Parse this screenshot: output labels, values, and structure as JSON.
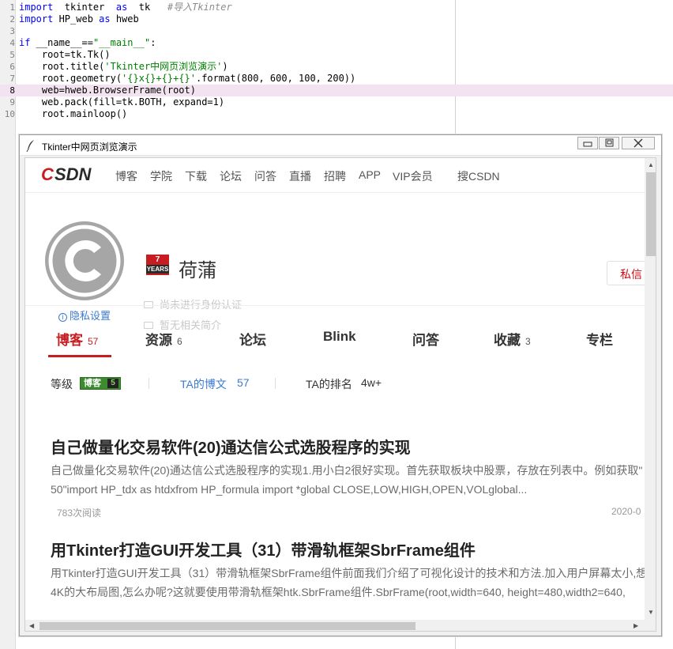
{
  "editor": {
    "lines": [
      {
        "num": "1",
        "parts": [
          {
            "t": "import",
            "c": "kw"
          },
          {
            "t": "  tkinter  ",
            "c": ""
          },
          {
            "t": "as",
            "c": "kw"
          },
          {
            "t": "  tk   ",
            "c": ""
          },
          {
            "t": "#导入Tkinter",
            "c": "cm"
          }
        ]
      },
      {
        "num": "2",
        "parts": [
          {
            "t": "import",
            "c": "kw"
          },
          {
            "t": " HP_web ",
            "c": ""
          },
          {
            "t": "as",
            "c": "kw"
          },
          {
            "t": " hweb",
            "c": ""
          }
        ]
      },
      {
        "num": "3",
        "parts": []
      },
      {
        "num": "4",
        "parts": [
          {
            "t": "if",
            "c": "kw"
          },
          {
            "t": " __name__==",
            "c": ""
          },
          {
            "t": "\"__main__\"",
            "c": "str"
          },
          {
            "t": ":",
            "c": ""
          }
        ]
      },
      {
        "num": "5",
        "parts": [
          {
            "t": "    root=tk.Tk()",
            "c": ""
          }
        ]
      },
      {
        "num": "6",
        "parts": [
          {
            "t": "    root.title(",
            "c": ""
          },
          {
            "t": "'Tkinter中网页浏览演示'",
            "c": "str"
          },
          {
            "t": ")",
            "c": ""
          }
        ]
      },
      {
        "num": "7",
        "parts": [
          {
            "t": "    root.geometry(",
            "c": ""
          },
          {
            "t": "'{}x{}+{}+{}'",
            "c": "str"
          },
          {
            "t": ".format(800, 600, 100, 200))",
            "c": ""
          }
        ]
      },
      {
        "num": "8",
        "parts": [
          {
            "t": "    web=hweb.BrowserFrame(root)",
            "c": ""
          }
        ]
      },
      {
        "num": "9",
        "parts": [
          {
            "t": "    web.pack(fill=tk.BOTH, expand=1)",
            "c": ""
          }
        ]
      },
      {
        "num": "10",
        "parts": [
          {
            "t": "    root.mainloop()",
            "c": ""
          }
        ]
      }
    ],
    "current_line": "8"
  },
  "window": {
    "title": "Tkinter中网页浏览演示"
  },
  "nav": {
    "logo": "CSDN",
    "items": [
      "博客",
      "学院",
      "下载",
      "论坛",
      "问答",
      "直播",
      "招聘",
      "APP",
      "VIP会员",
      "搜CSDN"
    ]
  },
  "profile": {
    "years_number": "7",
    "years_label": "YEARS",
    "username": "荷蒲",
    "verify_text": "尚未进行身份认证",
    "bio_text": "暂无相关简介",
    "privacy_label": "隐私设置",
    "message_button": "私信"
  },
  "tabs": [
    {
      "label": "博客",
      "count": "57",
      "active": true
    },
    {
      "label": "资源",
      "count": "6",
      "active": false
    },
    {
      "label": "论坛",
      "count": "",
      "active": false
    },
    {
      "label": "Blink",
      "count": "",
      "active": false
    },
    {
      "label": "问答",
      "count": "",
      "active": false
    },
    {
      "label": "收藏",
      "count": "3",
      "active": false
    },
    {
      "label": "专栏",
      "count": "",
      "active": false
    }
  ],
  "stats": {
    "level_label": "等级",
    "badge_text": "博客",
    "badge_level": "5",
    "articles_label": "TA的博文",
    "articles_value": "57",
    "rank_label": "TA的排名",
    "rank_value": "4w+"
  },
  "articles": [
    {
      "title": "自己做量化交易软件(20)通达信公式选股程序的实现",
      "desc1": "自己做量化交易软件(20)通达信公式选股程序的实现1.用小白2很好实现。首先获取板块中股票，存放在列表中。例如获取\"",
      "desc2": "50\"import HP_tdx as htdxfrom HP_formula import *global CLOSE,LOW,HIGH,OPEN,VOLglobal...",
      "reads": "783次阅读",
      "date": "2020-0"
    },
    {
      "title": "用Tkinter打造GUI开发工具（31）带滑轨框架SbrFrame组件",
      "desc1": "用Tkinter打造GUI开发工具（31）带滑轨框架SbrFrame组件前面我们介绍了可视化设计的技术和方法.加入用户屏幕太小,想",
      "desc2": "4K的大布局图,怎么办呢?这就要使用带滑轨框架htk.SbrFrame组件.SbrFrame(root,width=640, height=480,width2=640,"
    }
  ],
  "colors": {
    "csdn_red": "#c81d20",
    "link_blue": "#3c7ad0",
    "badge_green": "#3d8b2f",
    "code_keyword": "#0000ff",
    "code_string": "#008000",
    "current_line_highlight": "#f3e3f0"
  }
}
